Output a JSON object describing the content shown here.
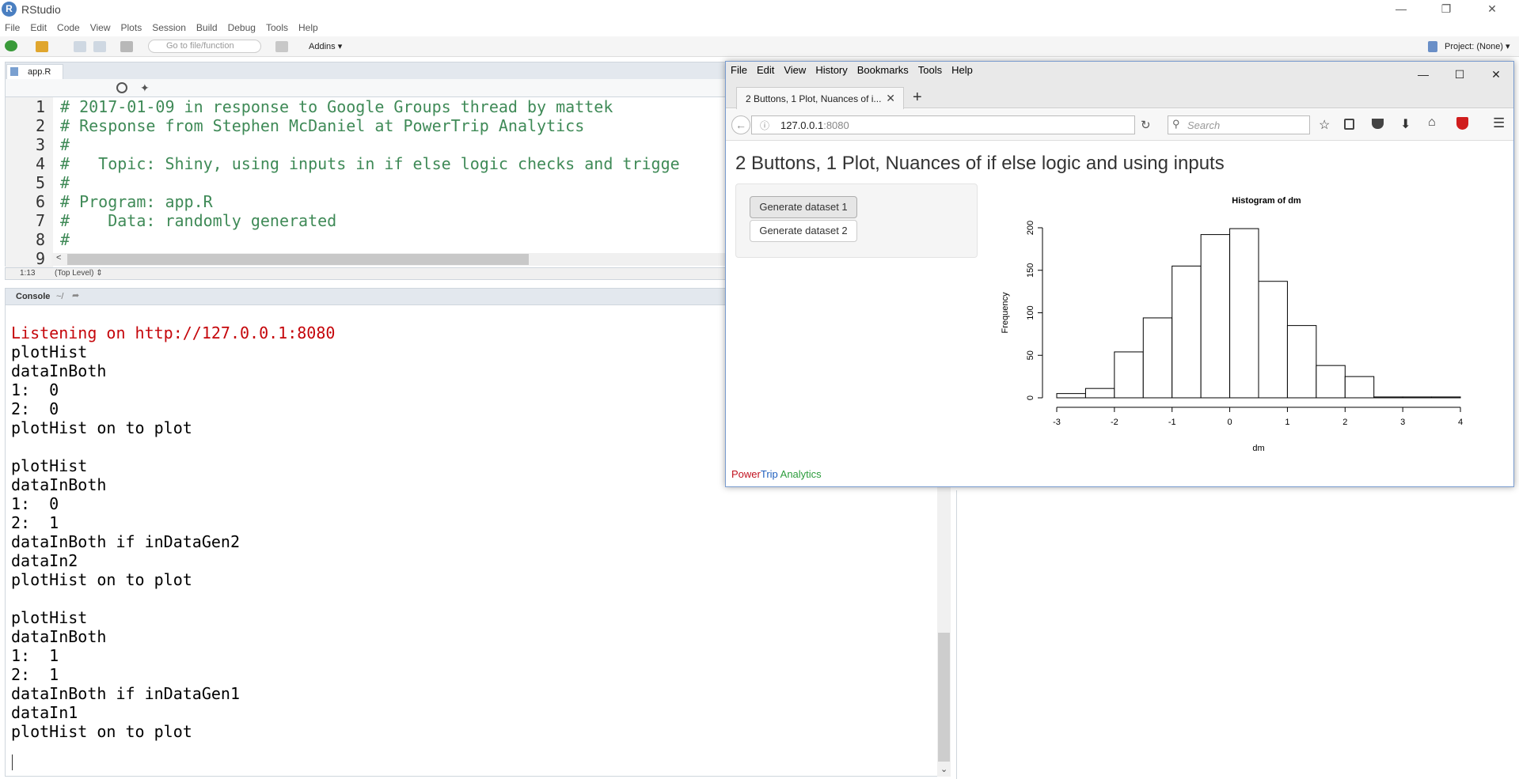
{
  "rstudio": {
    "title": "RStudio",
    "menu": [
      "File",
      "Edit",
      "Code",
      "View",
      "Plots",
      "Session",
      "Build",
      "Debug",
      "Tools",
      "Help"
    ],
    "goto_placeholder": "Go to file/function",
    "addins": "Addins",
    "project": "Project: (None)"
  },
  "editor": {
    "tab": "app.R",
    "line_numbers": [
      "1",
      "2",
      "3",
      "4",
      "5",
      "6",
      "7",
      "8",
      "9"
    ],
    "lines": [
      "# 2017-01-09 in response to Google Groups thread by mattek",
      "# Response from Stephen McDaniel at PowerTrip Analytics",
      "#",
      "#   Topic: Shiny, using inputs in if else logic checks and trigge",
      "#",
      "# Program: app.R",
      "#    Data: randomly generated",
      "#",
      ""
    ],
    "cursor": "1:13",
    "scope": "(Top Level)"
  },
  "console": {
    "title": "Console",
    "path": "~/",
    "lines": [
      {
        "text": "Listening on http://127.0.0.1:8080",
        "color": "#c5060b"
      },
      {
        "text": "plotHist",
        "color": "#000000"
      },
      {
        "text": "dataInBoth",
        "color": "#000000"
      },
      {
        "text": "1:  0",
        "color": "#000000"
      },
      {
        "text": "2:  0",
        "color": "#000000"
      },
      {
        "text": "plotHist on to plot",
        "color": "#000000"
      },
      {
        "text": "",
        "color": "#000000"
      },
      {
        "text": "plotHist",
        "color": "#000000"
      },
      {
        "text": "dataInBoth",
        "color": "#000000"
      },
      {
        "text": "1:  0",
        "color": "#000000"
      },
      {
        "text": "2:  1",
        "color": "#000000"
      },
      {
        "text": "dataInBoth if inDataGen2",
        "color": "#000000"
      },
      {
        "text": "dataIn2",
        "color": "#000000"
      },
      {
        "text": "plotHist on to plot",
        "color": "#000000"
      },
      {
        "text": "",
        "color": "#000000"
      },
      {
        "text": "plotHist",
        "color": "#000000"
      },
      {
        "text": "dataInBoth",
        "color": "#000000"
      },
      {
        "text": "1:  1",
        "color": "#000000"
      },
      {
        "text": "2:  1",
        "color": "#000000"
      },
      {
        "text": "dataInBoth if inDataGen1",
        "color": "#000000"
      },
      {
        "text": "dataIn1",
        "color": "#000000"
      },
      {
        "text": "plotHist on to plot",
        "color": "#000000"
      }
    ]
  },
  "firefox": {
    "menu": [
      "File",
      "Edit",
      "View",
      "History",
      "Bookmarks",
      "Tools",
      "Help"
    ],
    "tab_title": "2 Buttons, 1 Plot, Nuances of i...",
    "url_host": "127.0.0.1",
    "url_port": ":8080",
    "search_placeholder": "Search"
  },
  "shiny": {
    "title": "2 Buttons, 1 Plot, Nuances of if else logic and using inputs",
    "button1": "Generate dataset 1",
    "button2": "Generate dataset 2",
    "footer": {
      "part1": "Power",
      "part2": "Trip",
      "part3": " Analytics"
    }
  },
  "chart_data": {
    "type": "bar",
    "title": "Histogram of dm",
    "xlabel": "dm",
    "ylabel": "Frequency",
    "bin_edges": [
      -3,
      -2.5,
      -2,
      -1.5,
      -1,
      -0.5,
      0,
      0.5,
      1,
      1.5,
      2,
      2.5,
      3,
      3.5,
      4
    ],
    "values": [
      5,
      11,
      54,
      94,
      155,
      192,
      199,
      137,
      85,
      38,
      25,
      1,
      1,
      1
    ],
    "xticks": [
      "-3",
      "-2",
      "-1",
      "0",
      "1",
      "2",
      "3",
      "4"
    ],
    "yticks": [
      "0",
      "50",
      "100",
      "150",
      "200"
    ],
    "xlim": [
      -3,
      4
    ],
    "ylim": [
      0,
      200
    ],
    "grid": false
  }
}
